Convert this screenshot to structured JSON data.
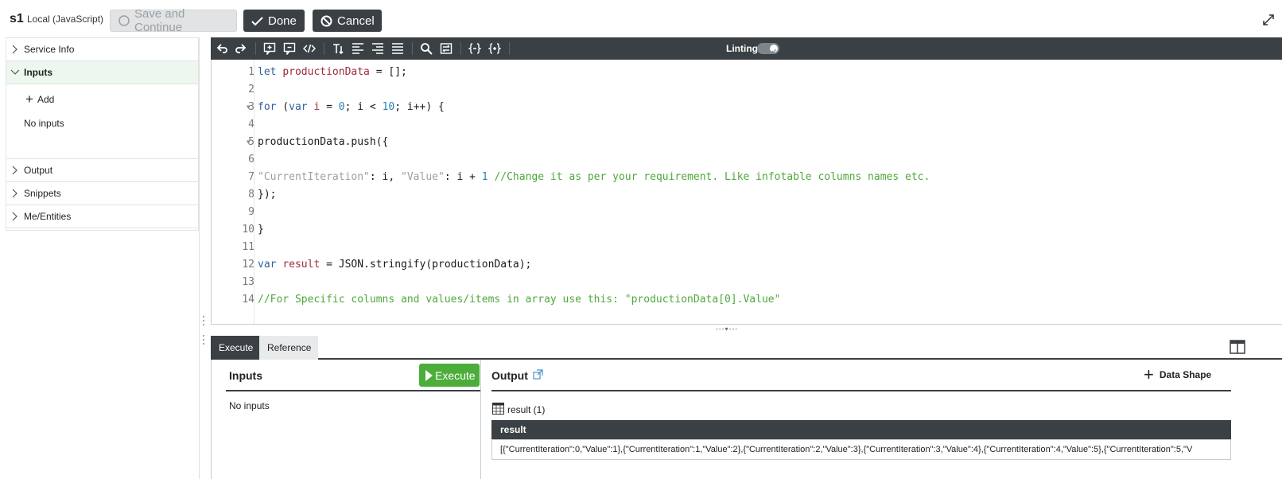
{
  "header": {
    "service_name": "s1",
    "service_type": "Local (JavaScript)",
    "save_label": "Save and Continue",
    "done_label": "Done",
    "cancel_label": "Cancel"
  },
  "sidebar": {
    "items": [
      {
        "label": "Service Info",
        "expanded": false
      },
      {
        "label": "Inputs",
        "expanded": true
      },
      {
        "label": "Output",
        "expanded": false
      },
      {
        "label": "Snippets",
        "expanded": false
      },
      {
        "label": "Me/Entities",
        "expanded": false
      }
    ],
    "add_label": "Add",
    "no_inputs": "No inputs"
  },
  "toolbar": {
    "linting_label": "Linting",
    "linting_on": true
  },
  "editor": {
    "line_numbers": [
      "1",
      "2",
      "3",
      "4",
      "5",
      "6",
      "7",
      "8",
      "9",
      "10",
      "11",
      "12",
      "13",
      "14"
    ],
    "lines": [
      "let productionData = [];",
      "",
      "for (var i = 0; i < 10; i++) {",
      "",
      "productionData.push({",
      "",
      "\"CurrentIteration\": i, \"Value\": i + 1 //Change it as per your requirement. Like infotable columns names etc.",
      "});",
      "",
      "}",
      "",
      "var result = JSON.stringify(productionData);",
      "",
      "//For Specific columns and values/items in array use this: \"productionData[0].Value\""
    ],
    "tokens": {
      "l1_kw": "let",
      "l1_var": "productionData",
      "l1_rest": " = [];",
      "l3_kw": "for",
      "l3_a": " (",
      "l3_kw2": "var",
      "l3_var": "i",
      "l3_b": " = ",
      "l3_n0": "0",
      "l3_c": "; i < ",
      "l3_n10": "10",
      "l3_d": "; i++) {",
      "l5": "productionData.push({",
      "l7_s1": "\"CurrentIteration\"",
      "l7_a": ": i, ",
      "l7_s2": "\"Value\"",
      "l7_b": ": i + ",
      "l7_n1": "1",
      "l7_cmt": " //Change it as per your requirement. Like infotable columns names etc.",
      "l8": "});",
      "l10": "}",
      "l12_kw": "var",
      "l12_var": "result",
      "l12_rest": " = JSON.stringify(productionData);",
      "l14_cmt": "//For Specific columns and values/items in array use this: \"productionData[0].Value\""
    },
    "splitter": "◦◦◦▾◦◦◦"
  },
  "bottom": {
    "tabs": [
      "Execute",
      "Reference"
    ],
    "active_tab": "Execute",
    "inputs_title": "Inputs",
    "execute_label": "Execute",
    "no_inputs": "No inputs",
    "output_title": "Output",
    "data_shape_label": "Data Shape",
    "result_label": "result (1)",
    "result_column": "result",
    "result_value": "[{\"CurrentIteration\":0,\"Value\":1},{\"CurrentIteration\":1,\"Value\":2},{\"CurrentIteration\":2,\"Value\":3},{\"CurrentIteration\":3,\"Value\":4},{\"CurrentIteration\":4,\"Value\":5},{\"CurrentIteration\":5,\"V"
  },
  "colors": {
    "dark": "#3a4043",
    "execute_green": "#4cad3a",
    "active_sidebar": "#eef7ee"
  }
}
